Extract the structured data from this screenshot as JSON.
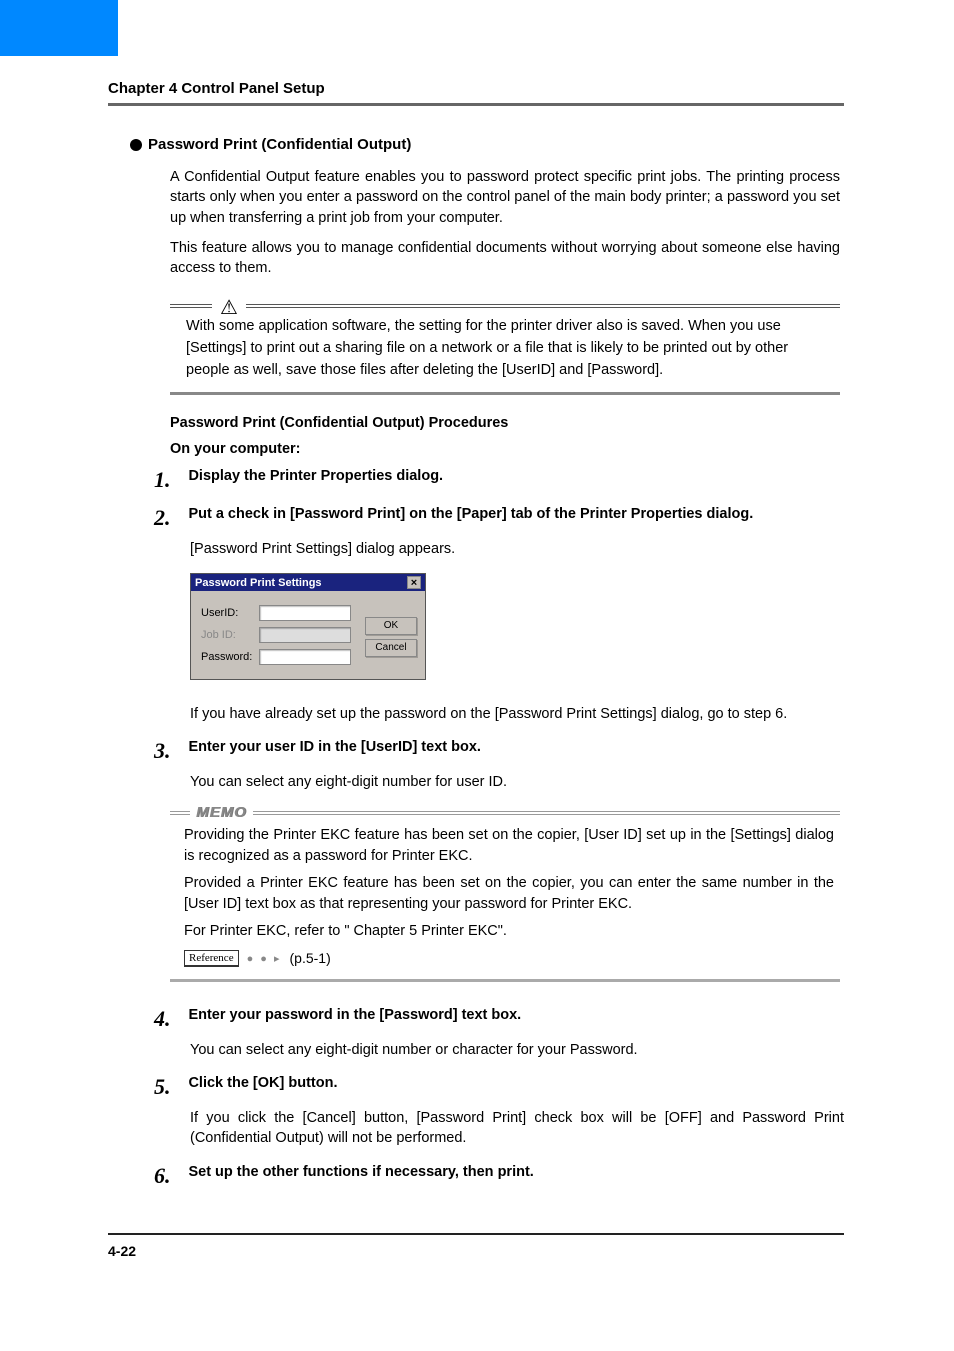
{
  "header": {
    "chapter": "Chapter 4 Control Panel Setup"
  },
  "section": {
    "title": "Password Print (Confidential Output)"
  },
  "intro": {
    "p1": "A Confidential Output feature enables you to password protect specific print jobs. The printing process starts only when you enter a password on the control panel of the main body printer; a password you set up when transferring a print job from your computer.",
    "p2": "This feature allows you to manage confidential documents without worrying about someone else having access to them."
  },
  "caution": {
    "text": "With some application software, the setting for the printer driver also is saved. When you use [Settings] to print out a sharing file on a network or a file that is likely to be printed out by other people as well, save those files after deleting the [UserID] and [Password]."
  },
  "procedures": {
    "heading": "Password Print (Confidential Output) Procedures",
    "sub": "On your computer:"
  },
  "steps": {
    "s1": {
      "num": "1.",
      "title": "Display the Printer Properties dialog."
    },
    "s2": {
      "num": "2.",
      "title": "Put a check in [Password Print] on the [Paper] tab of the Printer Properties dialog.",
      "body1": "[Password Print Settings] dialog appears.",
      "body2": "If you have already set up the password on the [Password Print Settings] dialog, go to step 6."
    },
    "s3": {
      "num": "3.",
      "title": "Enter your user ID in the [UserID] text box.",
      "body": "You can select any eight-digit number for user ID."
    },
    "s4": {
      "num": "4.",
      "title": "Enter your password in the [Password] text box.",
      "body": "You can select any eight-digit number or character for your Password."
    },
    "s5": {
      "num": "5.",
      "title": "Click the [OK] button.",
      "body": "If you click the [Cancel] button, [Password Print] check box will be [OFF] and Password Print (Confidential Output) will not be performed."
    },
    "s6": {
      "num": "6.",
      "title": "Set up the other functions if necessary, then print."
    }
  },
  "dialog": {
    "title": "Password Print Settings",
    "userid": "UserID:",
    "jobid": "Job ID:",
    "password": "Password:",
    "ok": "OK",
    "cancel": "Cancel"
  },
  "memo": {
    "label": "MEMO",
    "p1": "Providing the Printer EKC feature has been set on the copier, [User ID] set up in the [Settings] dialog is recognized as a password for Printer EKC.",
    "p2": "Provided a Printer EKC feature has been set on the copier, you can enter the same number in the [User ID] text box as that representing your password for Printer EKC.",
    "p3": "For Printer EKC, refer to \" Chapter 5 Printer EKC\".",
    "reference_label": "Reference",
    "reference_page": "(p.5-1)"
  },
  "footer": {
    "page": "4-22"
  }
}
